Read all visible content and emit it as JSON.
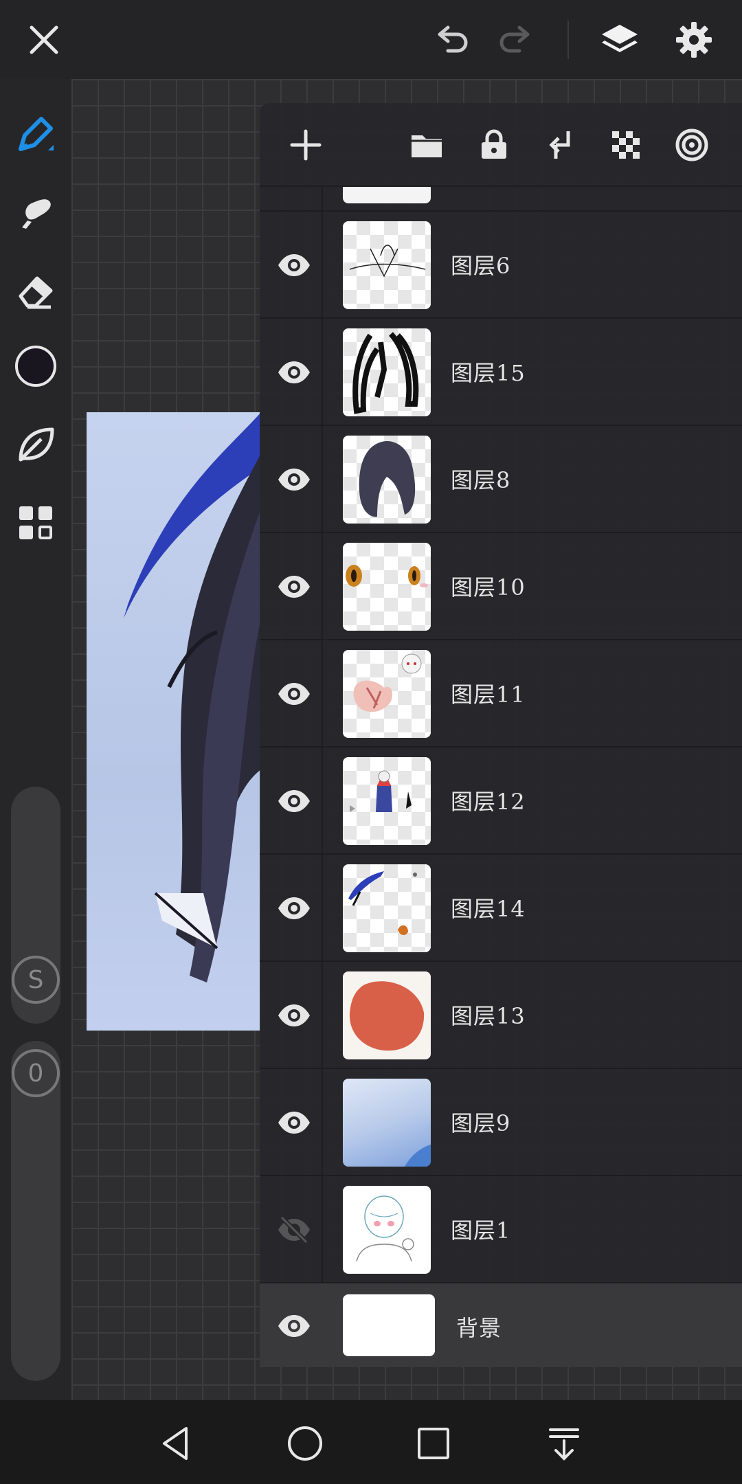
{
  "app": {
    "colors": {
      "accent": "#1e8fe6",
      "panel": "#28282b",
      "canvas": "#2e2e30",
      "toolbar": "#262628",
      "primary_color": "#1a1620"
    }
  },
  "topbar": {
    "icons": [
      "close-icon",
      "undo-icon",
      "redo-icon",
      "layers-icon",
      "settings-icon"
    ]
  },
  "toolbar": {
    "tools": [
      "pen-tool-icon",
      "smudge-tool-icon",
      "eraser-icon",
      "color-swatch",
      "leaf-icon",
      "gallery-grid-icon"
    ],
    "size_slider_label": "S",
    "opacity_slider_label": "0"
  },
  "layers_panel": {
    "header_icons": [
      "add-layer-icon",
      "folder-icon",
      "lock-icon",
      "merge-down-icon",
      "transparency-icon",
      "target-icon"
    ],
    "layers": [
      {
        "name": "图层6",
        "visible": true
      },
      {
        "name": "图层15",
        "visible": true
      },
      {
        "name": "图层8",
        "visible": true
      },
      {
        "name": "图层10",
        "visible": true
      },
      {
        "name": "图层11",
        "visible": true
      },
      {
        "name": "图层12",
        "visible": true
      },
      {
        "name": "图层14",
        "visible": true
      },
      {
        "name": "图层13",
        "visible": true
      },
      {
        "name": "图层9",
        "visible": true
      },
      {
        "name": "图层1",
        "visible": false
      },
      {
        "name": "背景",
        "visible": true
      }
    ]
  },
  "navbar": {
    "icons": [
      "back-icon",
      "home-icon",
      "recents-icon",
      "notification-shade-icon"
    ]
  }
}
